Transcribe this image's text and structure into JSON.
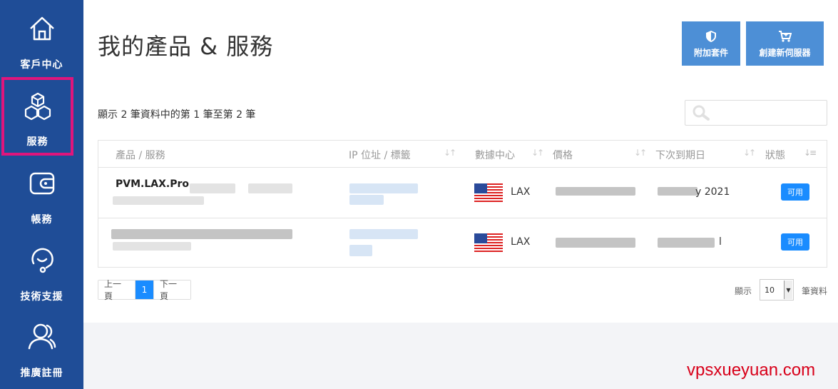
{
  "sidebar": {
    "items": [
      {
        "label": "客戶中心",
        "icon": "home-icon"
      },
      {
        "label": "服務",
        "icon": "cubes-icon"
      },
      {
        "label": "帳務",
        "icon": "wallet-icon"
      },
      {
        "label": "技術支援",
        "icon": "support-icon"
      },
      {
        "label": "推廣註冊",
        "icon": "user-group-icon"
      }
    ]
  },
  "header": {
    "title": "我的產品 & 服務",
    "addon_label": "附加套件",
    "new_server_label": "創建新伺服器"
  },
  "table": {
    "info": "顯示 2 筆資料中的第 1 筆至第 2 筆",
    "search_placeholder": "",
    "columns": [
      "產品 / 服務",
      "IP 位址 / 標籤",
      "數據中心",
      "價格",
      "下次到期日",
      "狀態"
    ],
    "rows": [
      {
        "product": "PVM.LAX.Pro.",
        "datacenter": "LAX",
        "due_suffix": "y 2021",
        "status": "可用"
      },
      {
        "product": "",
        "datacenter": "LAX",
        "due_suffix": "l",
        "status": "可用"
      }
    ]
  },
  "pagination": {
    "prev": "上一頁",
    "current": "1",
    "next": "下一頁",
    "show_label": "顯示",
    "per_page": "10",
    "records_label": "筆資料"
  },
  "watermark": "vpsxueyuan.com",
  "colors": {
    "sidebar": "#1f4d97",
    "active_outline": "#e0157c",
    "button": "#4d8fd6",
    "status": "#1a8cff"
  }
}
